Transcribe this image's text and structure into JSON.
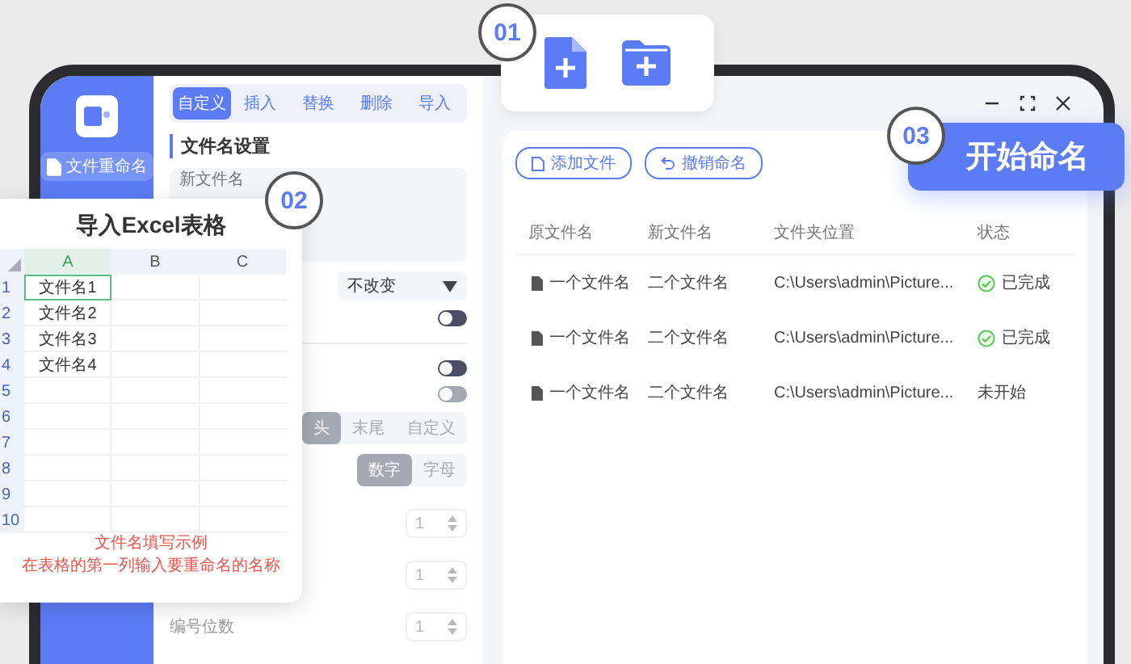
{
  "sidebar": {
    "items": [
      {
        "label": "文件重命名",
        "selected": true
      }
    ]
  },
  "tabs": [
    {
      "label": "自定义",
      "selected": true
    },
    {
      "label": "插入",
      "selected": false
    },
    {
      "label": "替换",
      "selected": false
    },
    {
      "label": "删除",
      "selected": false
    },
    {
      "label": "导入",
      "selected": false
    }
  ],
  "settings": {
    "section_title": "文件名设置",
    "new_name": {
      "placeholder": "新文件名"
    },
    "dropdown": {
      "value": "不改变"
    },
    "toggles": [
      {
        "on": false,
        "disabled": false
      },
      {
        "on": false,
        "disabled": false
      },
      {
        "on": false,
        "disabled": true
      }
    ],
    "position": [
      {
        "label": "头",
        "selected": true
      },
      {
        "label": "末尾",
        "selected": false
      },
      {
        "label": "自定义",
        "selected": false
      }
    ],
    "numbering_type": [
      {
        "label": "数字",
        "selected": true
      },
      {
        "label": "字母",
        "selected": false
      }
    ],
    "steppers": [
      {
        "value": "1"
      },
      {
        "value": "1"
      },
      {
        "label": "编号位数",
        "value": "1"
      }
    ]
  },
  "toolbar": {
    "buttons": [
      {
        "label": "添加文件",
        "kind": "add"
      },
      {
        "label": "撤销命名",
        "kind": "undo"
      }
    ]
  },
  "table": {
    "columns": [
      "原文件名",
      "新文件名",
      "文件夹位置",
      "状态"
    ],
    "rows": [
      {
        "original": "一个文件名",
        "new": "二个文件名",
        "folder": "C:\\Users\\admin\\Picture...",
        "status": "已完成",
        "done": true
      },
      {
        "original": "一个文件名",
        "new": "二个文件名",
        "folder": "C:\\Users\\admin\\Picture...",
        "status": "已完成",
        "done": true
      },
      {
        "original": "一个文件名",
        "new": "二个文件名",
        "folder": "C:\\Users\\admin\\Picture...",
        "status": "未开始",
        "done": false
      }
    ]
  },
  "start_button": {
    "label": "开始命名"
  },
  "callouts": [
    "01",
    "02",
    "03"
  ],
  "excel_popup": {
    "title": "导入Excel表格",
    "columns": [
      {
        "label": "A",
        "selected": true
      },
      {
        "label": "B",
        "selected": false
      },
      {
        "label": "C",
        "selected": false
      }
    ],
    "rows": [
      {
        "number": "1",
        "cell": "文件名1",
        "selected": true
      },
      {
        "number": "2",
        "cell": "文件名2",
        "selected": false
      },
      {
        "number": "3",
        "cell": "文件名3",
        "selected": false
      },
      {
        "number": "4",
        "cell": "文件名4",
        "selected": false
      },
      {
        "number": "5",
        "selected": false
      },
      {
        "number": "6",
        "selected": false
      },
      {
        "number": "7",
        "selected": false
      },
      {
        "number": "8",
        "selected": false
      },
      {
        "number": "9",
        "selected": false
      },
      {
        "number": "10",
        "selected": false
      }
    ],
    "notes": [
      "文件名填写示例",
      "在表格的第一列输入要重命名的名称"
    ]
  }
}
